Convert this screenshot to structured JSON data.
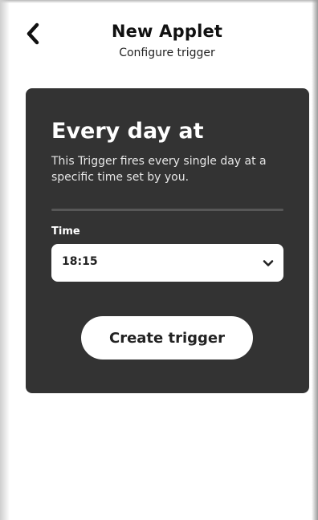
{
  "header": {
    "title": "New Applet",
    "subtitle": "Configure trigger",
    "back_icon": "chevron-left-icon"
  },
  "trigger": {
    "title": "Every day at",
    "description": "This Trigger fires every single day at a specific time set by you.",
    "time_label": "Time",
    "time_value": "18:15",
    "dropdown_icon": "chevron-down-icon",
    "create_button_label": "Create trigger"
  },
  "colors": {
    "card_background": "#333333",
    "page_background": "#ffffff",
    "button_background": "#ffffff"
  }
}
